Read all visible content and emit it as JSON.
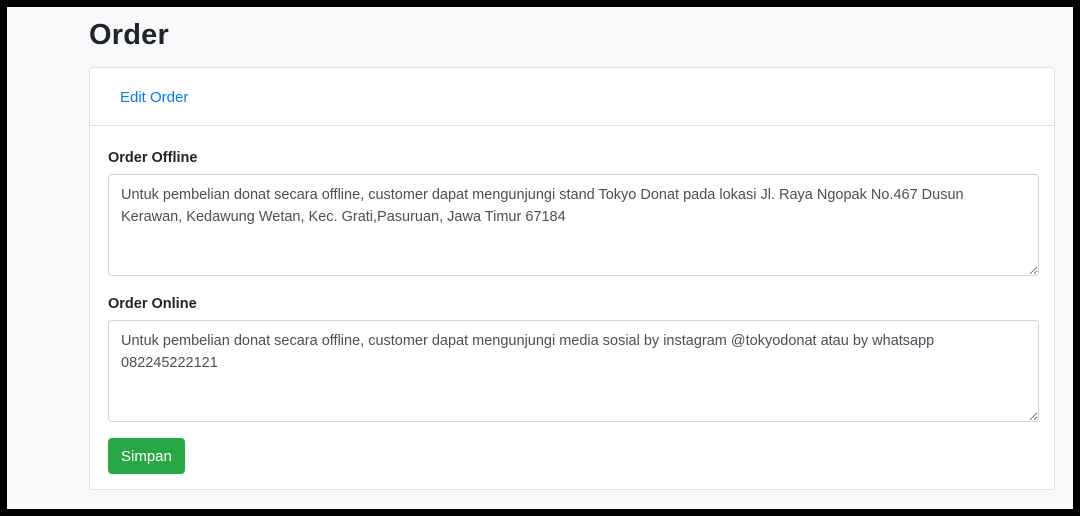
{
  "page": {
    "title": "Order"
  },
  "card": {
    "header_link": "Edit Order"
  },
  "form": {
    "offline": {
      "label": "Order Offline",
      "value": "Untuk pembelian donat secara offline, customer dapat mengunjungi stand Tokyo Donat pada lokasi Jl. Raya Ngopak No.467 Dusun Kerawan, Kedawung Wetan, Kec. Grati,Pasuruan, Jawa Timur 67184"
    },
    "online": {
      "label": "Order Online",
      "value": "Untuk pembelian donat secara offline, customer dapat mengunjungi media sosial by instagram @tokyodonat atau by whatsapp 082245222121"
    },
    "save_label": "Simpan"
  },
  "colors": {
    "link": "#007bff",
    "save_button": "#28a745",
    "page_background": "#f8f9fa",
    "frame": "#000000"
  }
}
